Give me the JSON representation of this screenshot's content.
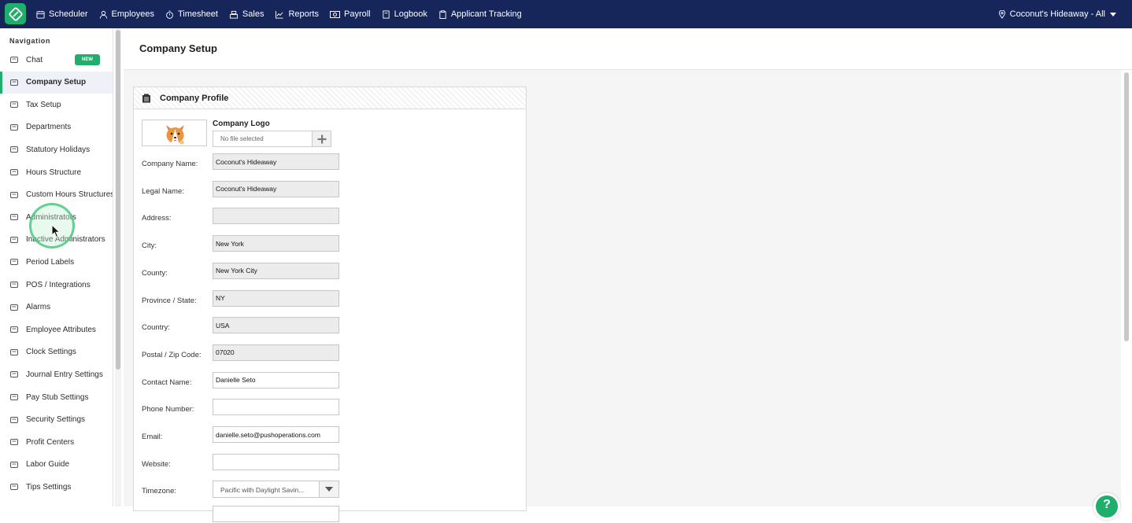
{
  "topnav": {
    "items": [
      {
        "label": "Scheduler",
        "icon": "calendar-icon"
      },
      {
        "label": "Employees",
        "icon": "person-icon"
      },
      {
        "label": "Timesheet",
        "icon": "stopwatch-icon"
      },
      {
        "label": "Sales",
        "icon": "register-icon"
      },
      {
        "label": "Reports",
        "icon": "chart-line-icon"
      },
      {
        "label": "Payroll",
        "icon": "money-icon"
      },
      {
        "label": "Logbook",
        "icon": "book-icon"
      },
      {
        "label": "Applicant Tracking",
        "icon": "clipboard-icon"
      }
    ],
    "location": "Coconut's Hideaway - All"
  },
  "sidebar": {
    "heading": "Navigation",
    "badge_new": "NEW",
    "items": [
      {
        "label": "Chat",
        "icon": "chat-icon"
      },
      {
        "label": "Company Setup",
        "icon": "company-icon",
        "active": true
      },
      {
        "label": "Tax Setup",
        "icon": "tax-icon"
      },
      {
        "label": "Departments",
        "icon": "departments-icon"
      },
      {
        "label": "Statutory Holidays",
        "icon": "holiday-icon"
      },
      {
        "label": "Hours Structure",
        "icon": "hours-icon"
      },
      {
        "label": "Custom Hours Structures",
        "icon": "custom-hours-icon"
      },
      {
        "label": "Administrators",
        "icon": "admin-icon"
      },
      {
        "label": "Inactive Administrators",
        "icon": "inactive-admin-icon"
      },
      {
        "label": "Period Labels",
        "icon": "tag-icon"
      },
      {
        "label": "POS / Integrations",
        "icon": "integrations-icon"
      },
      {
        "label": "Alarms",
        "icon": "alarm-icon"
      },
      {
        "label": "Employee Attributes",
        "icon": "attributes-icon"
      },
      {
        "label": "Clock Settings",
        "icon": "clock-icon"
      },
      {
        "label": "Journal Entry Settings",
        "icon": "journal-icon"
      },
      {
        "label": "Pay Stub Settings",
        "icon": "paystub-icon"
      },
      {
        "label": "Security Settings",
        "icon": "lock-icon"
      },
      {
        "label": "Profit Centers",
        "icon": "profit-icon"
      },
      {
        "label": "Labor Guide",
        "icon": "labor-icon"
      },
      {
        "label": "Tips Settings",
        "icon": "tips-icon"
      }
    ]
  },
  "page": {
    "title": "Company Setup"
  },
  "profile": {
    "title": "Company Profile",
    "logo_label": "Company Logo",
    "file_placeholder": "No file selected",
    "fields": [
      {
        "label": "Company Name:",
        "value": "Coconut's Hideaway",
        "readonly": true
      },
      {
        "label": "Legal Name:",
        "value": "Coconut's Hideaway",
        "readonly": true
      },
      {
        "label": "Address:",
        "value": "",
        "readonly": true
      },
      {
        "label": "City:",
        "value": "New York",
        "readonly": true
      },
      {
        "label": "County:",
        "value": "New York City",
        "readonly": true
      },
      {
        "label": "Province / State:",
        "value": "NY",
        "readonly": true
      },
      {
        "label": "Country:",
        "value": "USA",
        "readonly": true
      },
      {
        "label": "Postal / Zip Code:",
        "value": "07020",
        "readonly": true
      },
      {
        "label": "Contact Name:",
        "value": "Danielle Seto",
        "readonly": false
      },
      {
        "label": "Phone Number:",
        "value": "",
        "readonly": false
      },
      {
        "label": "Email:",
        "value": "danielle.seto@pushoperations.com",
        "readonly": false
      },
      {
        "label": "Website:",
        "value": "",
        "readonly": false
      }
    ],
    "timezone_label": "Timezone:",
    "timezone_value": "Pacific with Daylight Savin..."
  },
  "help": {
    "label": "?"
  },
  "colors": {
    "nav_bg": "#16255a",
    "accent": "#1fae6b"
  }
}
